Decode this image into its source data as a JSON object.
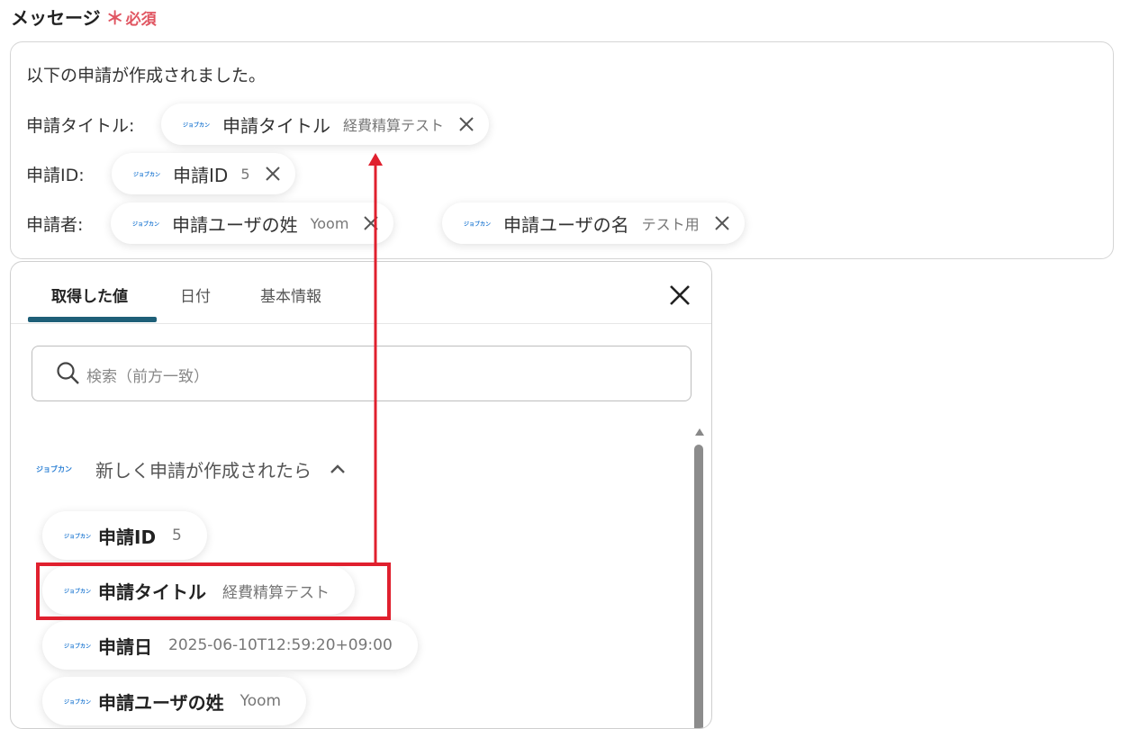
{
  "field": {
    "label": "メッセージ",
    "required_mark": "＊",
    "required_text": "必須"
  },
  "editor": {
    "line1": "以下の申請が作成されました。",
    "row_title_label": "申請タイトル:",
    "row_id_label": "申請ID:",
    "row_applicant_label": "申請者:",
    "chips": [
      {
        "logo": "ジョブカン",
        "name": "申請タイトル",
        "value": "経費精算テスト"
      },
      {
        "logo": "ジョブカン",
        "name": "申請ID",
        "value": "5"
      },
      {
        "logo": "ジョブカン",
        "name": "申請ユーザの姓",
        "value": "Yoom"
      },
      {
        "logo": "ジョブカン",
        "name": "申請ユーザの名",
        "value": "テスト用"
      }
    ]
  },
  "panel": {
    "tabs": [
      "取得した値",
      "日付",
      "基本情報"
    ],
    "active_tab": "取得した値",
    "search_placeholder": "検索（前方一致）",
    "group": {
      "logo": "ジョブカン",
      "title": "新しく申請が作成されたら"
    },
    "items": [
      {
        "logo": "ジョブカン",
        "name": "申請ID",
        "value": "5"
      },
      {
        "logo": "ジョブカン",
        "name": "申請タイトル",
        "value": "経費精算テスト"
      },
      {
        "logo": "ジョブカン",
        "name": "申請日",
        "value": "2025-06-10T12:59:20+09:00"
      },
      {
        "logo": "ジョブカン",
        "name": "申請ユーザの姓",
        "value": "Yoom"
      }
    ]
  },
  "colors": {
    "accent": "#1e5f78",
    "required": "#e05561",
    "annotation": "#e0202e",
    "logo": "#2a7fd4"
  }
}
